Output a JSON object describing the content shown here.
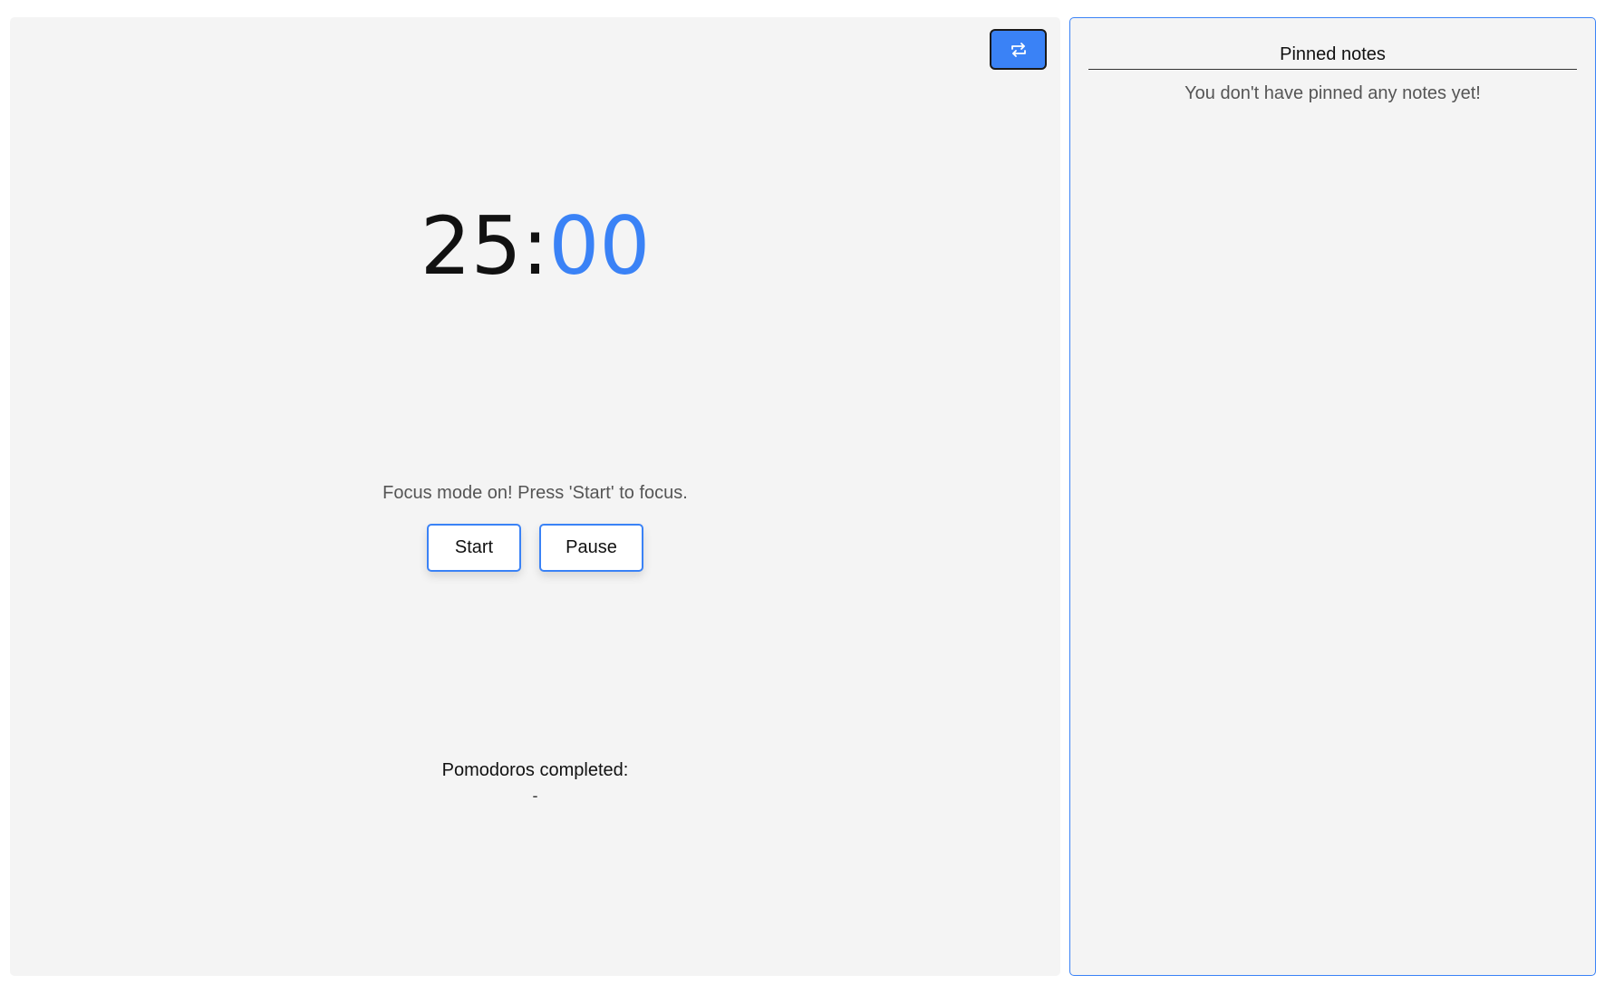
{
  "timer": {
    "minutes": "25",
    "separator": ":",
    "seconds": "00",
    "seconds_color": "#3a82f6"
  },
  "toolbar": {
    "mode_toggle_icon": "repeat-icon"
  },
  "status": {
    "message": "Focus mode on! Press 'Start' to focus."
  },
  "controls": {
    "start_label": "Start",
    "pause_label": "Pause"
  },
  "pomodoros": {
    "label": "Pomodoros completed:",
    "count": "-"
  },
  "notes": {
    "title": "Pinned notes",
    "empty_message": "You don't have pinned any notes yet!"
  },
  "colors": {
    "accent": "#3a82f6",
    "panel_background": "#f4f4f4"
  }
}
